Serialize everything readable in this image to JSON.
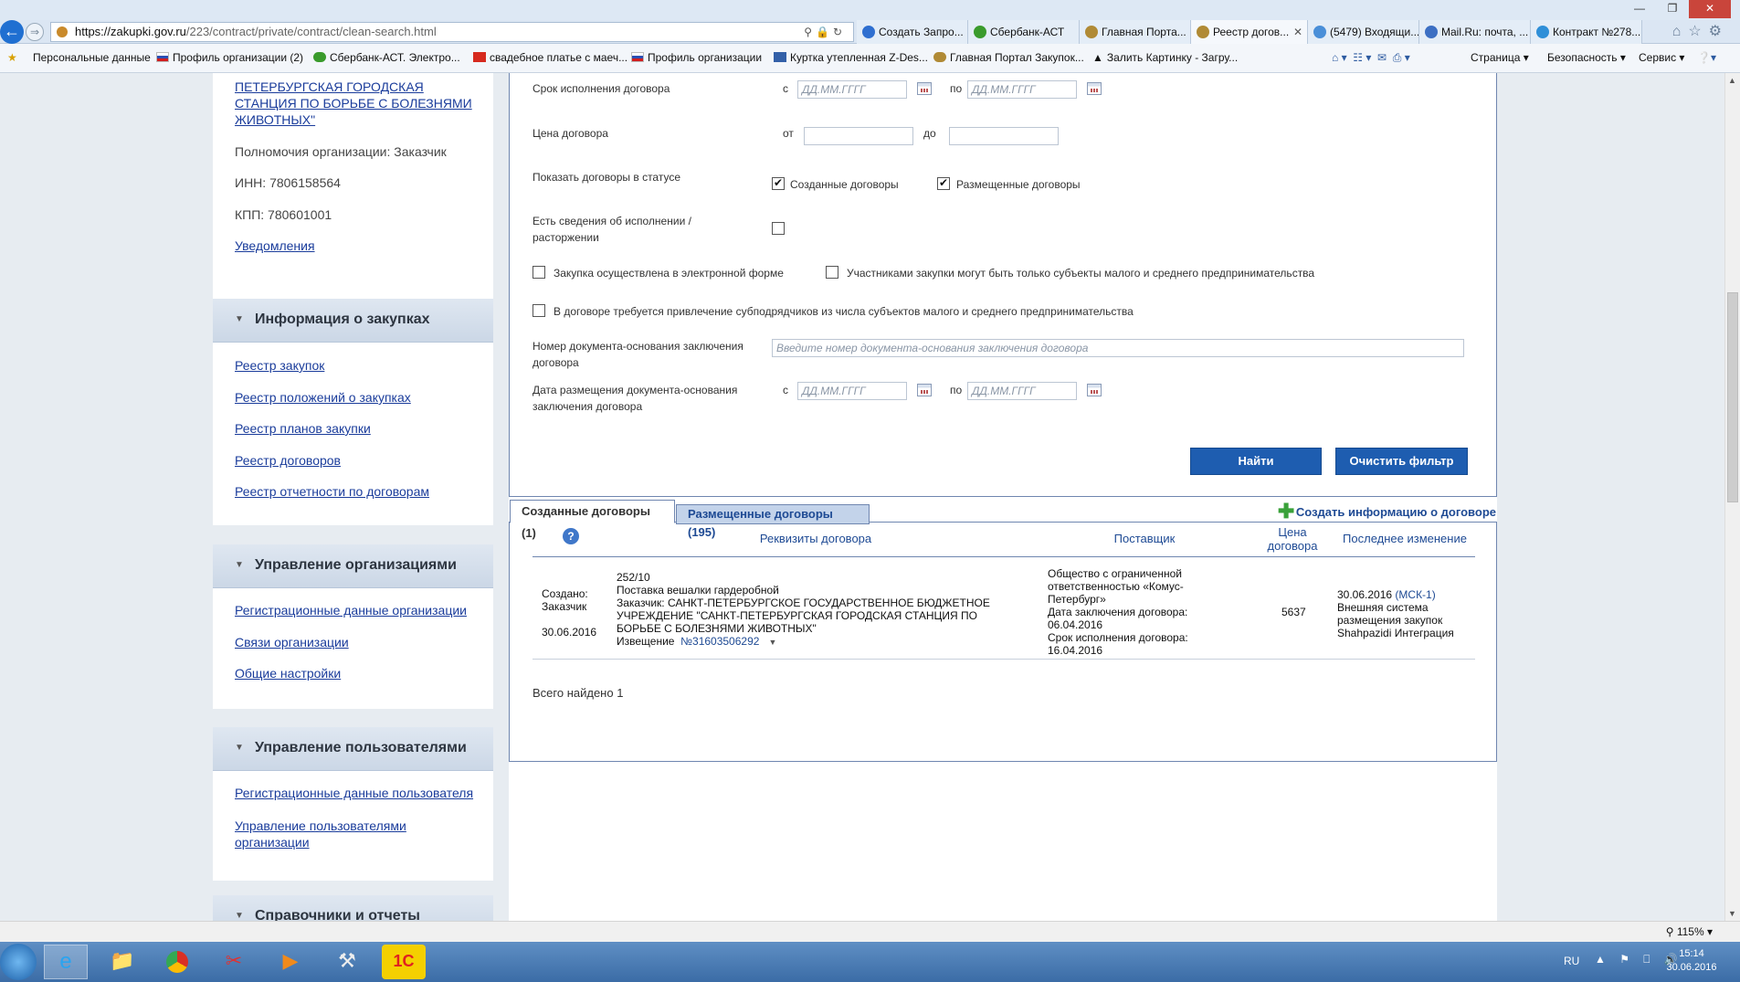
{
  "browser": {
    "url": "https://zakupki.gov.ru/223/contract/private/contract/clean-search.html",
    "url_host": "https://zakupki.gov.ru",
    "url_path": "/223/contract/private/contract/clean-search.html",
    "tabs": [
      {
        "label": "Создать Запро...",
        "color": "#2f6fd0"
      },
      {
        "label": "Сбербанк-АСТ",
        "color": "#3a9b2c"
      },
      {
        "label": "Главная Порта...",
        "color": "#b08a35"
      },
      {
        "label": "Реестр догов...",
        "color": "#b08a35",
        "active": true
      },
      {
        "label": "(5479) Входящи...",
        "color": "#4a8fd8"
      },
      {
        "label": "Mail.Ru: почта, ...",
        "color": "#3c6fc3"
      },
      {
        "label": "Контракт №278...",
        "color": "#2f8fd8"
      }
    ],
    "favorites": [
      "Персональные данные",
      "Профиль организации (2)",
      "Сбербанк-АСТ. Электро...",
      "свадебное платье с маеч...",
      "Профиль организации",
      "Куртка утепленная Z-Des...",
      "Главная Портал Закупок...",
      "Залить Картинку - Загру..."
    ],
    "commands": [
      "Страница ▾",
      "Безопасность ▾",
      "Сервис ▾"
    ]
  },
  "sidebar": {
    "org_name_tail": "ПЕТЕРБУРГСКАЯ ГОРОДСКАЯ СТАНЦИЯ ПО БОРЬБЕ С БОЛЕЗНЯМИ ЖИВОТНЫХ\"",
    "authority": "Полномочия организации: Заказчик",
    "inn": "ИНН: 7806158564",
    "kpp": "КПП: 780601001",
    "notifications": "Уведомления",
    "sections": [
      {
        "title": "Информация о закупках",
        "links": [
          "Реестр закупок",
          "Реестр положений о закупках",
          "Реестр планов закупки",
          "Реестр договоров",
          "Реестр отчетности по договорам"
        ]
      },
      {
        "title": "Управление организациями",
        "links": [
          "Регистрационные данные организации",
          "Связи организации",
          "Общие настройки"
        ]
      },
      {
        "title": "Управление пользователями",
        "links": [
          "Регистрационные данные пользователя",
          "Управление пользователями организации"
        ]
      },
      {
        "title": "Справочники и отчеты",
        "links": []
      }
    ]
  },
  "filter": {
    "term_label": "Срок исполнения договора",
    "from_word": "с",
    "to_word": "по",
    "date_placeholder": "ДД.ММ.ГГГГ",
    "price_label": "Цена договора",
    "price_from": "от",
    "price_to": "до",
    "status_label": "Показать договоры в статусе",
    "status_created": "Созданные договоры",
    "status_placed": "Размещенные договоры",
    "execution_label_1": "Есть сведения об исполнении /",
    "execution_label_2": "расторжении",
    "electronic": "Закупка осуществлена в электронной форме",
    "sme_only": "Участниками закупки могут быть только субъекты малого и среднего предпринимательства",
    "subcontract": "В договоре требуется привлечение субподрядчиков из числа субъектов малого и среднего предпринимательства",
    "docnum_label_1": "Номер документа-основания заключения",
    "docnum_label_2": "договора",
    "docnum_placeholder": "Введите номер документа-основания заключения договора",
    "docdate_label_1": "Дата размещения документа-основания",
    "docdate_label_2": "заключения договора",
    "find_button": "Найти",
    "clear_button": "Очистить фильтр"
  },
  "results": {
    "tab_created": "Созданные договоры (1)",
    "tab_placed": "Размещенные договоры (195)",
    "create_info": "Создать информацию о договоре",
    "columns": {
      "details": "Реквизиты договора",
      "supplier": "Поставщик",
      "price_1": "Цена",
      "price_2": "договора",
      "last_change": "Последнее изменение"
    },
    "row": {
      "created_1": "Создано:",
      "created_2": "Заказчик",
      "created_date": "30.06.2016",
      "number": "252/10",
      "subject": "Поставка вешалки гардеробной",
      "customer_1": "Заказчик: САНКТ-ПЕТЕРБУРГСКОЕ ГОСУДАРСТВЕННОЕ БЮДЖЕТНОЕ",
      "customer_2": "УЧРЕЖДЕНИЕ \"САНКТ-ПЕТЕРБУРГСКАЯ ГОРОДСКАЯ СТАНЦИЯ ПО",
      "customer_3": "БОРЬБЕ С БОЛЕЗНЯМИ ЖИВОТНЫХ\"",
      "notice_label": "Извещение",
      "notice_number": "№31603506292",
      "supplier_1": "Общество с ограниченной",
      "supplier_2": "ответственностью «Комус-",
      "supplier_3": "Петербург»",
      "concluded_label": "Дата заключения договора:",
      "concluded_date": "06.04.2016",
      "term_label": "Срок исполнения договора:",
      "term_date": "16.04.2016",
      "price": "5637",
      "change_date": "30.06.2016",
      "change_tz": "(МСК-1)",
      "change_1": "Внешняя система",
      "change_2": "размещения закупок",
      "change_3": "Shahpazidi Интеграция"
    },
    "total": "Всего найдено 1"
  },
  "statusbar": {
    "zoom": "115%"
  },
  "taskbar": {
    "lang": "RU",
    "time": "15:14",
    "date": "30.06.2016"
  }
}
